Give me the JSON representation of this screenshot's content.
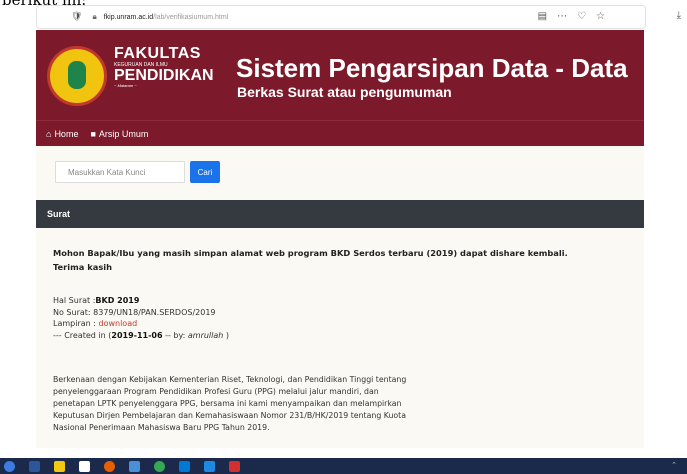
{
  "caption": {
    "text": "berikut ini:"
  },
  "browser": {
    "url_domain": "fkip.unram.ac.id",
    "url_path": "/lab/verifikasiumum.html",
    "icons": [
      "shield-icon",
      "lock-icon",
      "reader-icon",
      "more-icon",
      "pocket-icon",
      "star-icon",
      "download-icon"
    ]
  },
  "header": {
    "fac_line1": "FAKULTAS",
    "fac_line2": "KEGURUAN DAN ILMU",
    "fac_line3": "PENDIDIKAN",
    "fac_line4": "~ Mataram ~",
    "title": "Sistem Pengarsipan Data - Data",
    "subtitle": "Berkas Surat atau pengumuman"
  },
  "nav": {
    "home": "Home",
    "arsip": "Arsip Umum"
  },
  "search": {
    "placeholder": "Masukkan Kata Kunci",
    "button": "Cari"
  },
  "section": {
    "title": "Surat"
  },
  "post": {
    "heading_line1": "Mohon Bapak/Ibu yang masih simpan alamat web program BKD Serdos terbaru (2019) dapat dishare kembali.",
    "heading_line2": "Terima kasih",
    "hal_label": "Hal Surat :",
    "hal_value": "BKD 2019",
    "no_surat": "No Surat: 8379/UN18/PAN.SERDOS/2019",
    "lampiran_label": "Lampiran : ",
    "lampiran_link": "download",
    "created_prefix": "--- Created in (",
    "created_date": "2019-11-06",
    "created_mid": " -- by: ",
    "created_by": "amrullah",
    "created_suffix": " )",
    "body_line1": "Berkenaan dengan Kebijakan Kementerian Riset, Teknologi, dan Pendidikan Tinggi tentang",
    "body_line2": "penyelenggaraan Program Pendidikan Profesi Guru (PPG) melalui jalur mandiri, dan",
    "body_line3": "penetapan LPTK penyelenggara PPG, bersama ini kami menyampaikan dan melampirkan",
    "body_line4": "Keputusan Dirjen Pembelajaran dan Kemahasiswaan Nomor 231/B/HK/2019 tentang Kuota",
    "body_line5": "Nasional Penerimaan Mahasiswa Baru PPG Tahun 2019."
  },
  "colors": {
    "header": "#7c1a2c",
    "section_bar": "#343a40",
    "button": "#1a73e8",
    "link": "#c0392b"
  }
}
